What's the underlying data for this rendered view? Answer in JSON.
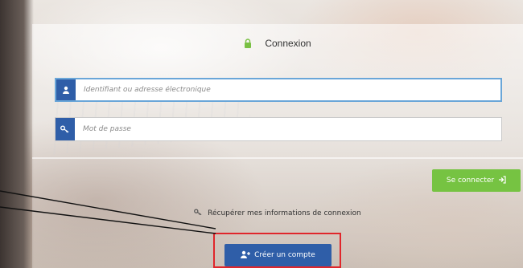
{
  "login": {
    "title": "Connexion",
    "username_placeholder": "Identifiant ou adresse électronique",
    "password_placeholder": "Mot de passe",
    "connect_label": "Se connecter",
    "recover_label": "Récupérer mes informations de connexion",
    "create_account_label": "Créer un compte"
  },
  "icons": {
    "title": "lock-icon",
    "username": "user-icon",
    "password": "key-icon",
    "connect": "sign-in-icon",
    "recover": "key-icon",
    "create": "user-plus-icon"
  },
  "colors": {
    "primary_blue": "#2f5ea8",
    "connect_green": "#76c342",
    "lock_green": "#79c043",
    "highlight_red": "#e0262b",
    "focus_border": "#6aa6d8"
  }
}
